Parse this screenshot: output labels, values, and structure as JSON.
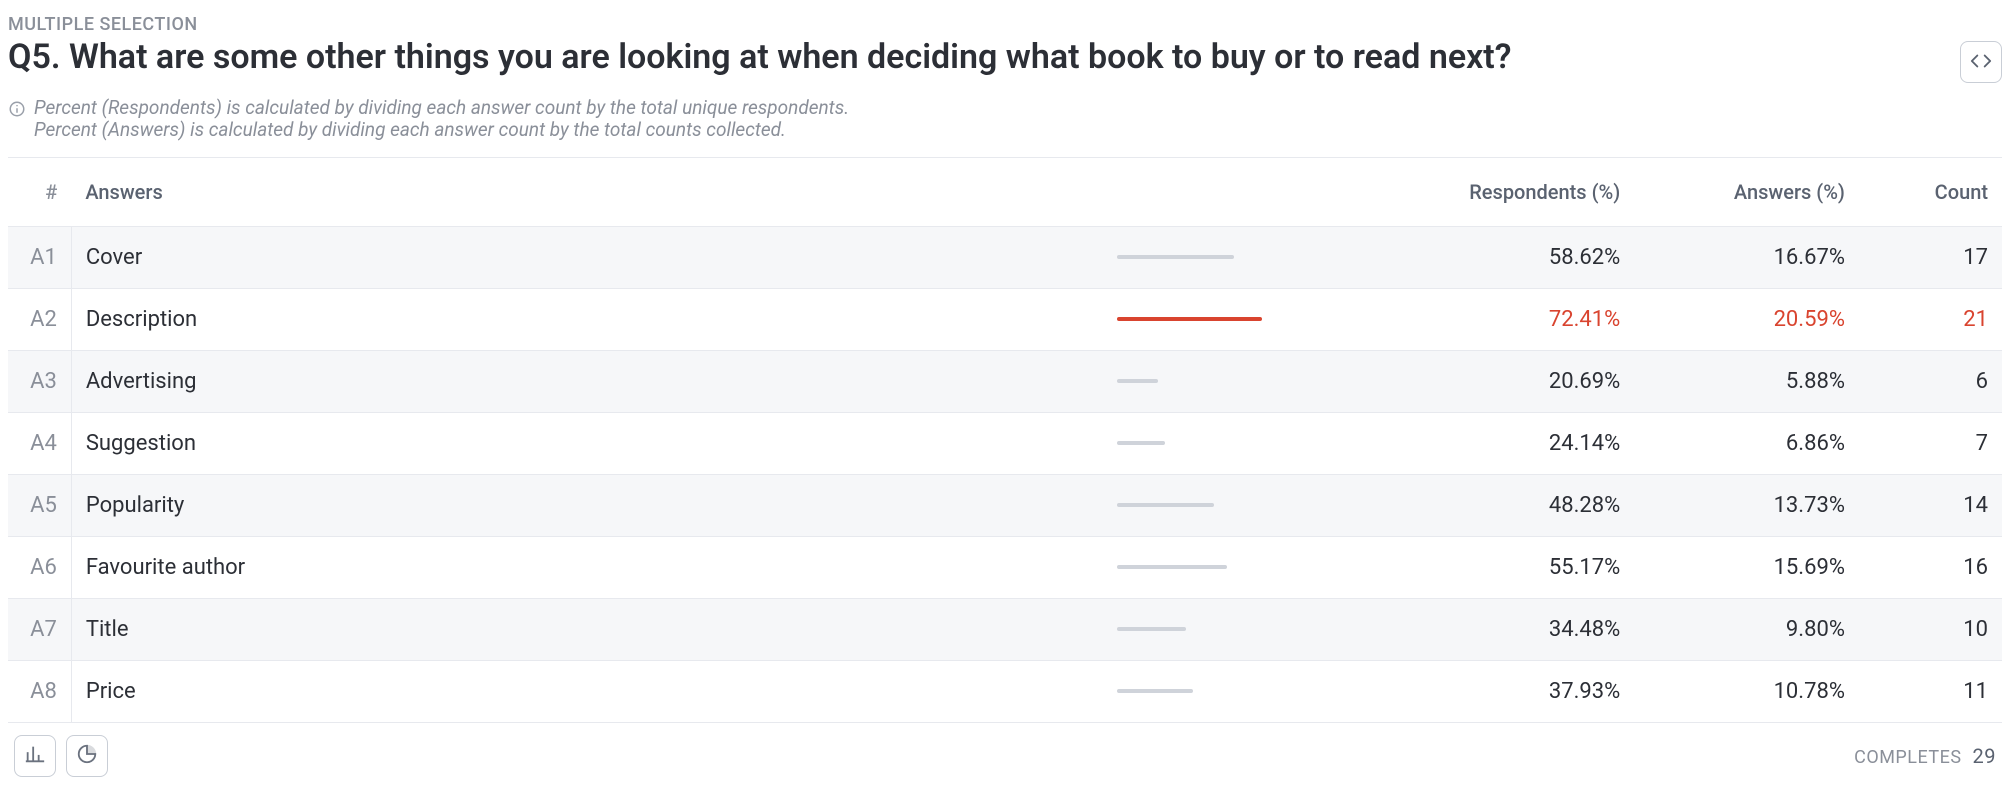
{
  "header": {
    "type_label": "MULTIPLE SELECTION",
    "title": "Q5. What are some other things you are looking at when deciding what book to buy or to read next?",
    "note1": "Percent (Respondents) is calculated by dividing each answer count by the total unique respondents.",
    "note2": "Percent (Answers) is calculated by dividing each answer count by the total counts collected."
  },
  "columns": {
    "idx": "#",
    "answers": "Answers",
    "respondents": "Respondents (%)",
    "answers_pct": "Answers (%)",
    "count": "Count"
  },
  "rows": [
    {
      "id": "A1",
      "label": "Cover",
      "resp": "58.62%",
      "ansp": "16.67%",
      "count": "17",
      "bar": 58.62,
      "hi": false
    },
    {
      "id": "A2",
      "label": "Description",
      "resp": "72.41%",
      "ansp": "20.59%",
      "count": "21",
      "bar": 72.41,
      "hi": true
    },
    {
      "id": "A3",
      "label": "Advertising",
      "resp": "20.69%",
      "ansp": "5.88%",
      "count": "6",
      "bar": 20.69,
      "hi": false
    },
    {
      "id": "A4",
      "label": "Suggestion",
      "resp": "24.14%",
      "ansp": "6.86%",
      "count": "7",
      "bar": 24.14,
      "hi": false
    },
    {
      "id": "A5",
      "label": "Popularity",
      "resp": "48.28%",
      "ansp": "13.73%",
      "count": "14",
      "bar": 48.28,
      "hi": false
    },
    {
      "id": "A6",
      "label": "Favourite author",
      "resp": "55.17%",
      "ansp": "15.69%",
      "count": "16",
      "bar": 55.17,
      "hi": false
    },
    {
      "id": "A7",
      "label": "Title",
      "resp": "34.48%",
      "ansp": "9.80%",
      "count": "10",
      "bar": 34.48,
      "hi": false
    },
    {
      "id": "A8",
      "label": "Price",
      "resp": "37.93%",
      "ansp": "10.78%",
      "count": "11",
      "bar": 37.93,
      "hi": false
    }
  ],
  "footer": {
    "completes_label": "COMPLETES",
    "completes_value": "29"
  },
  "chart_data": {
    "type": "bar",
    "orientation": "horizontal",
    "title": "Q5. What are some other things you are looking at when deciding what book to buy or to read next?",
    "categories": [
      "Cover",
      "Description",
      "Advertising",
      "Suggestion",
      "Popularity",
      "Favourite author",
      "Title",
      "Price"
    ],
    "series": [
      {
        "name": "Respondents (%)",
        "values": [
          58.62,
          72.41,
          20.69,
          24.14,
          48.28,
          55.17,
          34.48,
          37.93
        ]
      },
      {
        "name": "Answers (%)",
        "values": [
          16.67,
          20.59,
          5.88,
          6.86,
          13.73,
          15.69,
          9.8,
          10.78
        ]
      },
      {
        "name": "Count",
        "values": [
          17,
          21,
          6,
          7,
          14,
          16,
          10,
          11
        ]
      }
    ],
    "xlabel": "",
    "ylabel": "",
    "xlim": [
      0,
      100
    ],
    "highlight_index": 1,
    "completes": 29
  }
}
